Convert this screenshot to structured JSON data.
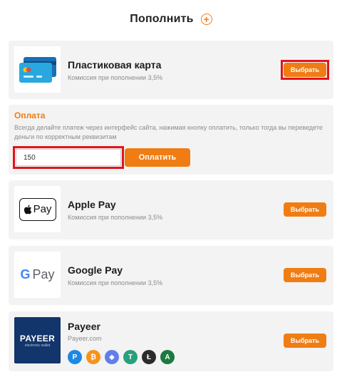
{
  "header": {
    "title": "Пополнить"
  },
  "methods": [
    {
      "name": "Пластиковая карта",
      "subtitle": "Комиссия при пополнении 3,5%",
      "button": "Выбрать",
      "logo": "card-icon"
    },
    {
      "name": "Apple Pay",
      "subtitle": "Комиссия при пополнении 3,5%",
      "button": "Выбрать",
      "logo": "apple-pay-logo",
      "logo_text": "Pay"
    },
    {
      "name": "Google Pay",
      "subtitle": "Комиссия при пополнении 3,5%",
      "button": "Выбрать",
      "logo": "google-pay-logo",
      "logo_text": "Pay",
      "logo_g": "G"
    },
    {
      "name": "Payeer",
      "subtitle": "Payeer.com",
      "button": "Выбрать",
      "logo": "payeer-logo",
      "logo_text": "PAYEER",
      "logo_sub": "electronic wallet",
      "coins": [
        {
          "icon": "payeer-coin-icon",
          "color": "#1e88e5",
          "glyph": "P"
        },
        {
          "icon": "bitcoin-icon",
          "color": "#f7931a",
          "glyph": "₿"
        },
        {
          "icon": "ethereum-icon",
          "color": "#627eea",
          "glyph": "◆"
        },
        {
          "icon": "tether-icon",
          "color": "#26a17b",
          "glyph": "T"
        },
        {
          "icon": "litecoin-icon",
          "color": "#2b2b2b",
          "glyph": "Ł"
        },
        {
          "icon": "advcash-icon",
          "color": "#1b7a3e",
          "glyph": "A"
        }
      ]
    }
  ],
  "payment": {
    "title": "Оплата",
    "note": "Всегда делайте платеж через интерфейс сайта, нажимая кнопку оплатить, только тогда вы переведете деньги по корректным реквизитам",
    "amount": "150",
    "button": "Оплатить"
  },
  "colors": {
    "accent": "#f07d14",
    "highlight": "#e0141e",
    "card_bg": "#f3f3f3"
  }
}
